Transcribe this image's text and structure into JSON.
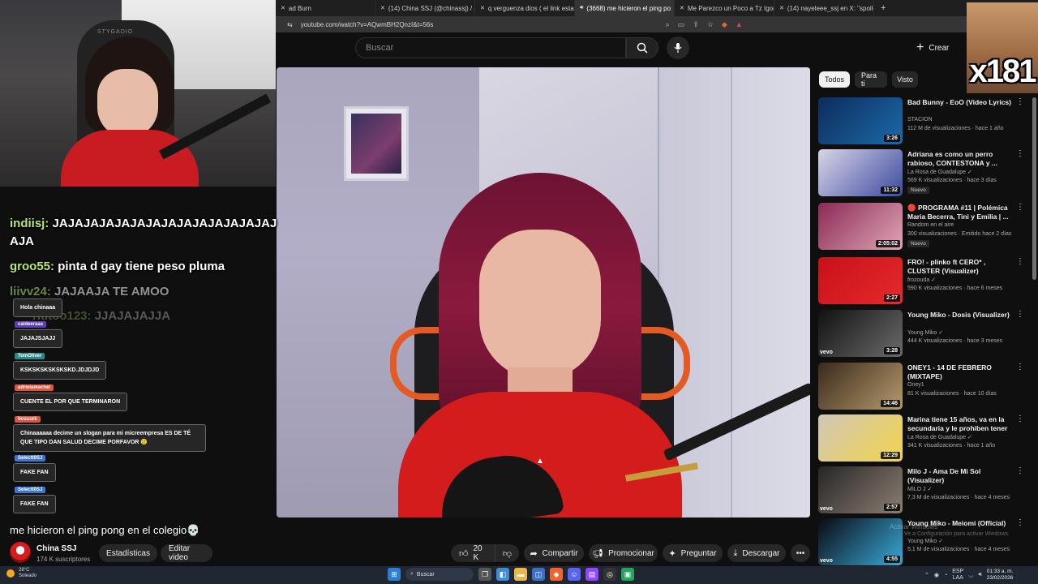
{
  "browser": {
    "tabs": [
      {
        "label": "ad Burn"
      },
      {
        "label": "(14) China SSJ (@chinassj) / X"
      },
      {
        "label": "q verguenza dios ( el link esta en su"
      },
      {
        "label": "(3668) me hicieron el ping po",
        "active": true
      },
      {
        "label": "Me Parezco un Poco a Tz Igor y Wim"
      },
      {
        "label": "(14) nayeleee_ssj en X: \"spoiler de m"
      }
    ],
    "url": "youtube.com/watch?v=AQwmBH2QnzI&t=56s",
    "new_tab": "+"
  },
  "youtube": {
    "search_placeholder": "Buscar",
    "create_label": "Crear"
  },
  "overlays": {
    "webcam_label": "STYGADIO",
    "reaction_count": "x181"
  },
  "chat": {
    "lines": [
      {
        "user": "indiisj:",
        "text": "JAJAJAJAJAJAJAJAJAJAJAJAJAJAJAJA"
      },
      {
        "user": "groo55:",
        "text": "pinta d gay tiene peso pluma"
      },
      {
        "user": "liivv24:",
        "text": "JAJAAJA TE AMOO"
      },
      {
        "user": "rititoo123:",
        "text": "JJAJAJAJJA"
      }
    ],
    "alerts": [
      {
        "user": "",
        "text": "Hola chinaaa"
      },
      {
        "user": "caldeeraas",
        "text": "JAJAJSJAJJ"
      },
      {
        "user": "TomOliver",
        "text": "KSKSKSKSKSKSKD.JDJDJD"
      },
      {
        "user": "adrielamachel",
        "text": "CUENTE EL POR QUE TERMINARON"
      },
      {
        "user": "bosuurk",
        "text": "Chinaaaaaa decime un slogan para mi micreempresa ES DE TÉ QUE TIPO DAN SALUD DECIME PORFAVOR 🥲"
      },
      {
        "user": "Selectt0SJ",
        "text": "FAKE FAN"
      },
      {
        "user": "Selectt0SJ",
        "text": "FAKE FAN"
      }
    ]
  },
  "video": {
    "title": "me hicieron el ping pong en el colegio💀",
    "channel": "China SSJ",
    "subscribers": "174 K suscriptores",
    "stats_button": "Estadísticas",
    "edit_button": "Editar video",
    "likes": "20 K",
    "share": "Compartir",
    "promote": "Promocionar",
    "ask": "Preguntar",
    "download": "Descargar"
  },
  "sidebar": {
    "chips": [
      "Todos",
      "Para ti",
      "Visto"
    ],
    "recommendations": [
      {
        "title": "Bad Bunny - EoO (Video Lyrics)",
        "channel": "STACION",
        "meta": "112 M de visualizaciones · hace 1 año",
        "duration": "3:26",
        "badge": "",
        "thumb_colors": [
          "#0d2c5c",
          "#1b6aa8"
        ],
        "vevo": false
      },
      {
        "title": "Adriana es como un perro rabioso, CONTESTONA y ...",
        "channel": "La Rosa de Guadalupe ✓",
        "meta": "569 K visualizaciones · hace 3 días",
        "duration": "11:32",
        "badge": "Nuevo",
        "thumb_colors": [
          "#d9d6e8",
          "#3d4aa0"
        ],
        "vevo": false
      },
      {
        "title": "🔴 PROGRAMA #11 | Polémica Maria Becerra, Tini y Emilia | ...",
        "channel": "Random en el aire",
        "meta": "300 visualizaciones · Emitido hace 2 días",
        "duration": "2:05:02",
        "badge": "Nuevo",
        "thumb_colors": [
          "#8a2a55",
          "#e0a6b6"
        ],
        "vevo": false
      },
      {
        "title": "FRO! - plinko ft CERO* , CLUSTER (Visualizer)",
        "channel": "frozouda ✓",
        "meta": "590 K visualizaciones · hace 6 meses",
        "duration": "2:27",
        "badge": "",
        "thumb_colors": [
          "#c8101a",
          "#e52a2a"
        ],
        "vevo": false
      },
      {
        "title": "Young Miko - Dosis (Visualizer)",
        "channel": "Young Miko ✓",
        "meta": "444 K visualizaciones · hace 3 meses",
        "duration": "3:28",
        "badge": "",
        "thumb_colors": [
          "#111111",
          "#6b6b6b"
        ],
        "vevo": true
      },
      {
        "title": "ONEY1 - 14 DE FEBRERO (MIXTAPE)",
        "channel": "Oney1",
        "meta": "81 K visualizaciones · hace 10 días",
        "duration": "14:46",
        "badge": "",
        "thumb_colors": [
          "#3a2a1c",
          "#b59a6c"
        ],
        "vevo": false
      },
      {
        "title": "Marina tiene 15 años, va en la secundaria y le prohiben tener ...",
        "channel": "La Rosa de Guadalupe ✓",
        "meta": "341 K visualizaciones · hace 1 año",
        "duration": "12:29",
        "badge": "",
        "thumb_colors": [
          "#d0c7b7",
          "#f2d44a"
        ],
        "vevo": false
      },
      {
        "title": "Milo J - Ama De Mi Sol (Visualizer)",
        "channel": "MILO J ✓",
        "meta": "7,3 M de visualizaciones · hace 4 meses",
        "duration": "2:57",
        "badge": "",
        "thumb_colors": [
          "#262626",
          "#8c7e72"
        ],
        "vevo": true
      },
      {
        "title": "Young Miko - Meiomi (Official)",
        "channel": "Young Miko ✓",
        "meta": "5,1 M de visualizaciones · hace 4 meses",
        "duration": "4:55",
        "badge": "",
        "thumb_colors": [
          "#0a0a12",
          "#39a9d8"
        ],
        "vevo": true
      }
    ]
  },
  "watermark": {
    "line1": "Activar Windows",
    "line2": "Ve a Configuración para activar Windows."
  },
  "taskbar": {
    "weather_temp": "28°C",
    "weather_state": "Soleado",
    "search_label": "Buscar",
    "lang": "ESP",
    "lang2": "LAA",
    "time": "01:33 a. m.",
    "date": "23/02/2026"
  },
  "colors": {
    "accent_red": "#ff0000",
    "chat_user": "#b9e86a",
    "bg": "#0f0f0f"
  }
}
